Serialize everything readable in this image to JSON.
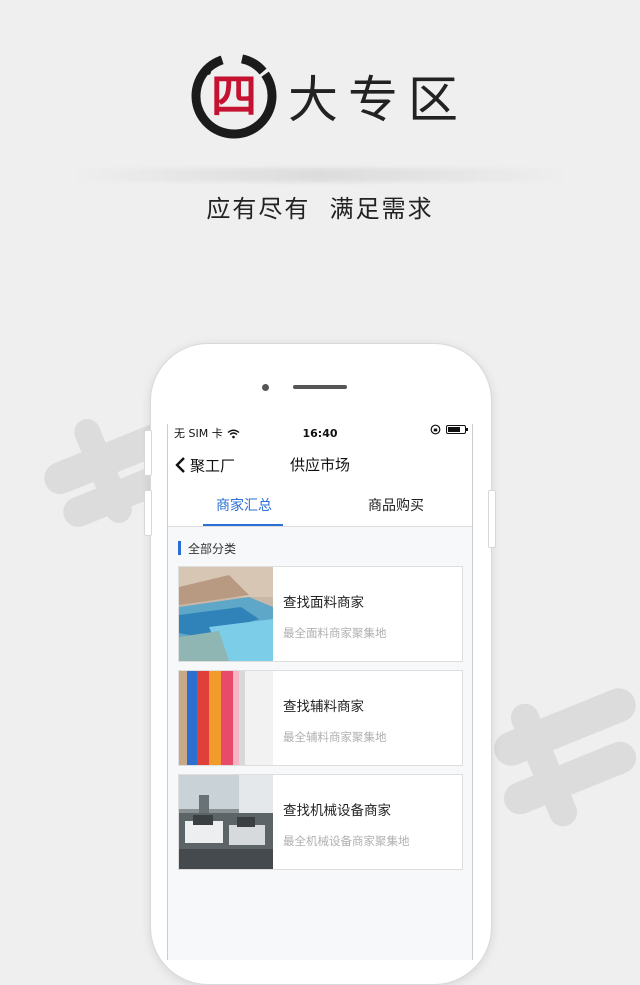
{
  "promo": {
    "title_highlight": "四",
    "title_rest": "大专区",
    "tagline": "应有尽有  满足需求"
  },
  "status_bar": {
    "carrier": "无 SIM 卡",
    "time": "16:40"
  },
  "nav": {
    "back_label": "聚工厂",
    "title": "供应市场"
  },
  "tabs": [
    {
      "label": "商家汇总",
      "active": true
    },
    {
      "label": "商品购买",
      "active": false
    }
  ],
  "section": {
    "title": "全部分类"
  },
  "categories": [
    {
      "title": "查找面料商家",
      "subtitle": "最全面料商家聚集地",
      "image": "fabric-rolls"
    },
    {
      "title": "查找辅料商家",
      "subtitle": "最全辅料商家聚集地",
      "image": "colored-ribbons"
    },
    {
      "title": "查找机械设备商家",
      "subtitle": "最全机械设备商家聚集地",
      "image": "sewing-machines"
    }
  ],
  "colors": {
    "accent": "#2a6fd6",
    "brand_red": "#c51231",
    "background": "#efefef"
  }
}
